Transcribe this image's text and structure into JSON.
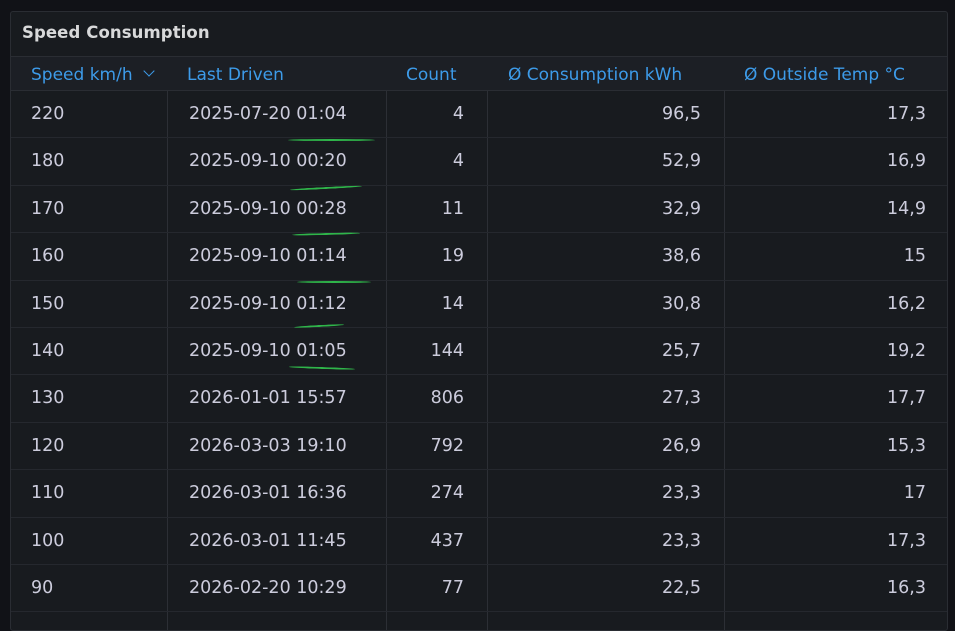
{
  "panel": {
    "title": "Speed Consumption"
  },
  "columns": {
    "speed": "Speed km/h",
    "last_driven": "Last Driven",
    "count": "Count",
    "consumption": "Ø Consumption kWh",
    "outside_temp": "Ø Outside Temp °C"
  },
  "sort": {
    "column": "speed",
    "direction": "descending",
    "icon": "chevron-down-icon"
  },
  "rows": [
    {
      "speed": "220",
      "last_driven": "2025-07-20 01:04",
      "count": "4",
      "consumption": "96,5",
      "outside_temp": "17,3"
    },
    {
      "speed": "180",
      "last_driven": "2025-09-10 00:20",
      "count": "4",
      "consumption": "52,9",
      "outside_temp": "16,9"
    },
    {
      "speed": "170",
      "last_driven": "2025-09-10 00:28",
      "count": "11",
      "consumption": "32,9",
      "outside_temp": "14,9"
    },
    {
      "speed": "160",
      "last_driven": "2025-09-10 01:14",
      "count": "19",
      "consumption": "38,6",
      "outside_temp": "15"
    },
    {
      "speed": "150",
      "last_driven": "2025-09-10 01:12",
      "count": "14",
      "consumption": "30,8",
      "outside_temp": "16,2"
    },
    {
      "speed": "140",
      "last_driven": "2025-09-10 01:05",
      "count": "144",
      "consumption": "25,7",
      "outside_temp": "19,2"
    },
    {
      "speed": "130",
      "last_driven": "2026-01-01 15:57",
      "count": "806",
      "consumption": "27,3",
      "outside_temp": "17,7"
    },
    {
      "speed": "120",
      "last_driven": "2026-03-03 19:10",
      "count": "792",
      "consumption": "26,9",
      "outside_temp": "15,3"
    },
    {
      "speed": "110",
      "last_driven": "2026-03-01 16:36",
      "count": "274",
      "consumption": "23,3",
      "outside_temp": "17"
    },
    {
      "speed": "100",
      "last_driven": "2026-03-01 11:45",
      "count": "437",
      "consumption": "23,3",
      "outside_temp": "17,3"
    },
    {
      "speed": "90",
      "last_driven": "2026-02-20 10:29",
      "count": "77",
      "consumption": "22,5",
      "outside_temp": "16,3"
    }
  ],
  "annotations": {
    "underline_color": "#2fb54a",
    "underlined_rows": [
      0,
      1,
      2,
      3,
      4,
      5
    ]
  },
  "colors": {
    "header_text": "#3d9be9",
    "cell_text": "#ccccdc",
    "panel_bg": "#181b1f"
  }
}
